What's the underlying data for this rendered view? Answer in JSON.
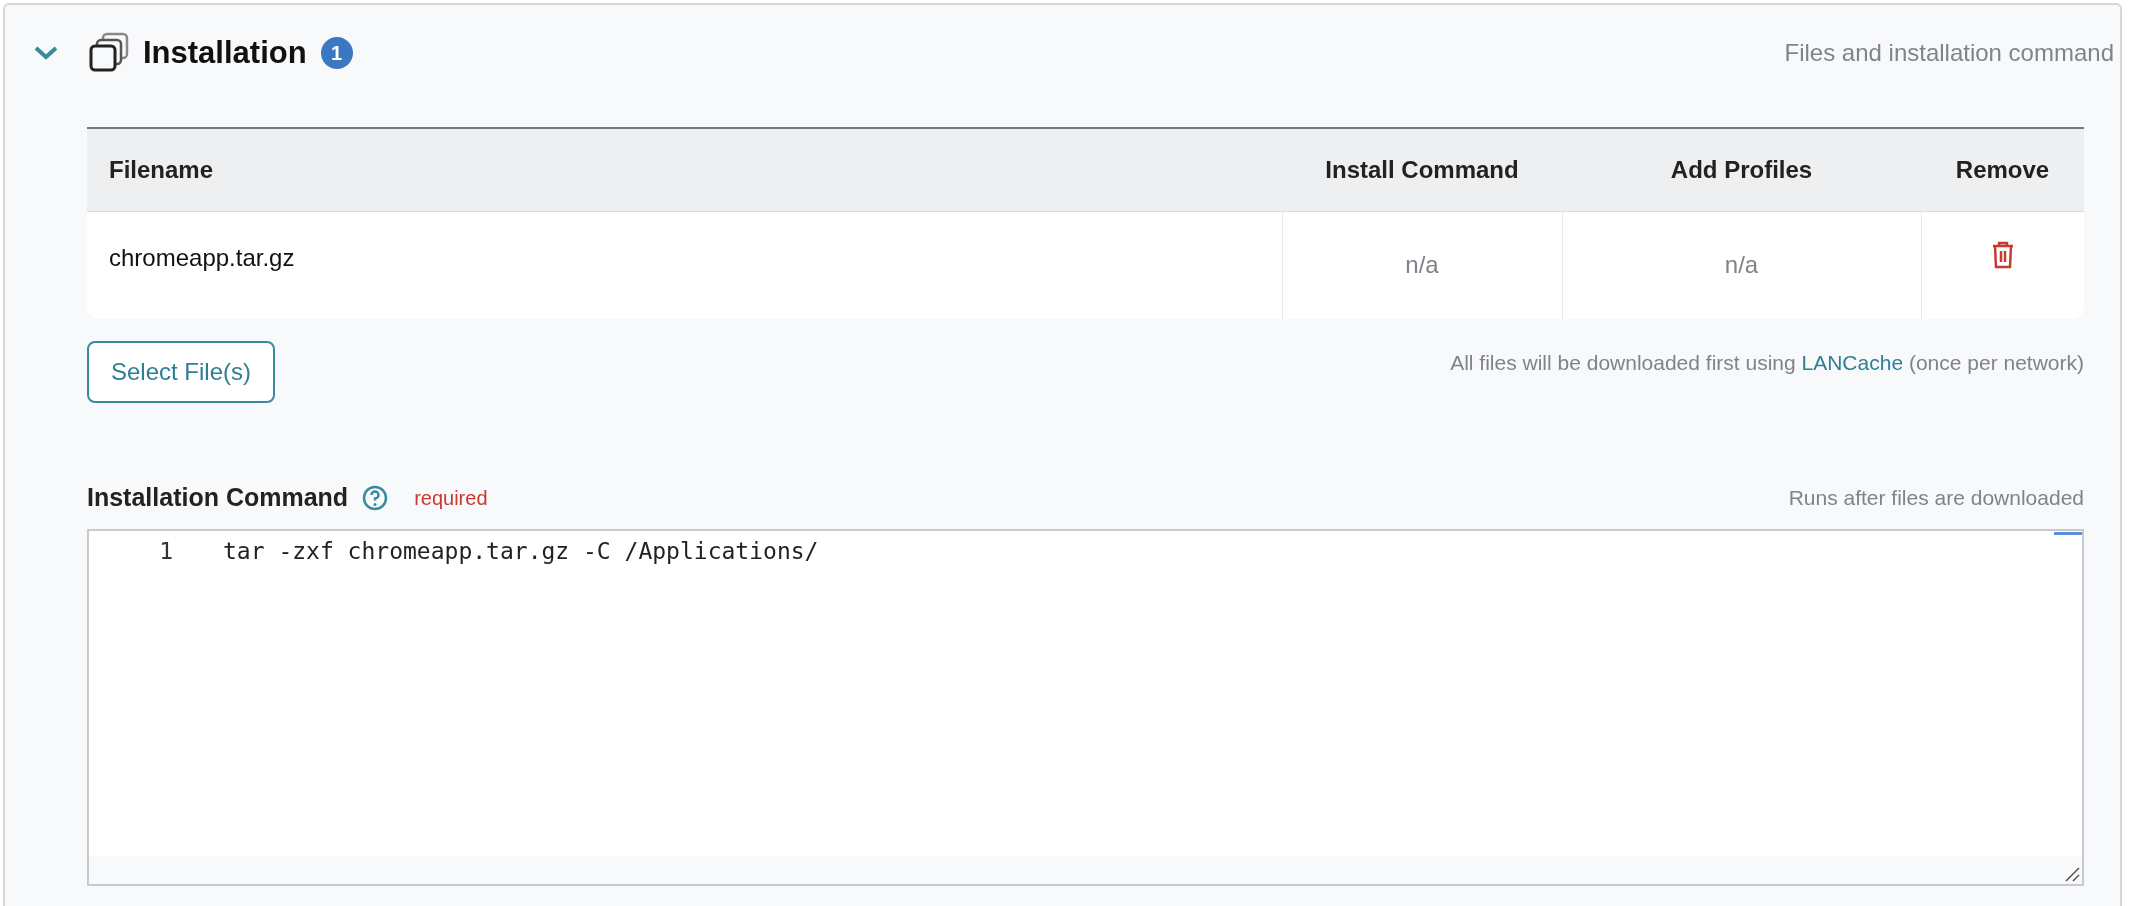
{
  "section": {
    "title": "Installation",
    "badge": "1",
    "expanded": true,
    "subtitle": "Files and installation command"
  },
  "files_table": {
    "columns": [
      "Filename",
      "Install Command",
      "Add Profiles",
      "Remove"
    ],
    "rows": [
      {
        "filename": "chromeapp.tar.gz",
        "install_command": "n/a",
        "add_profiles": "n/a"
      }
    ]
  },
  "select_button": "Select File(s)",
  "download_note": {
    "before": "All files will be downloaded first using ",
    "link": "LANCache",
    "after": " (once per network)"
  },
  "command": {
    "label": "Installation Command",
    "required": "required",
    "hint": "Runs after files are downloaded",
    "lines": [
      {
        "number": "1",
        "code": "tar -zxf chromeapp.tar.gz -C /Applications/"
      }
    ]
  }
}
